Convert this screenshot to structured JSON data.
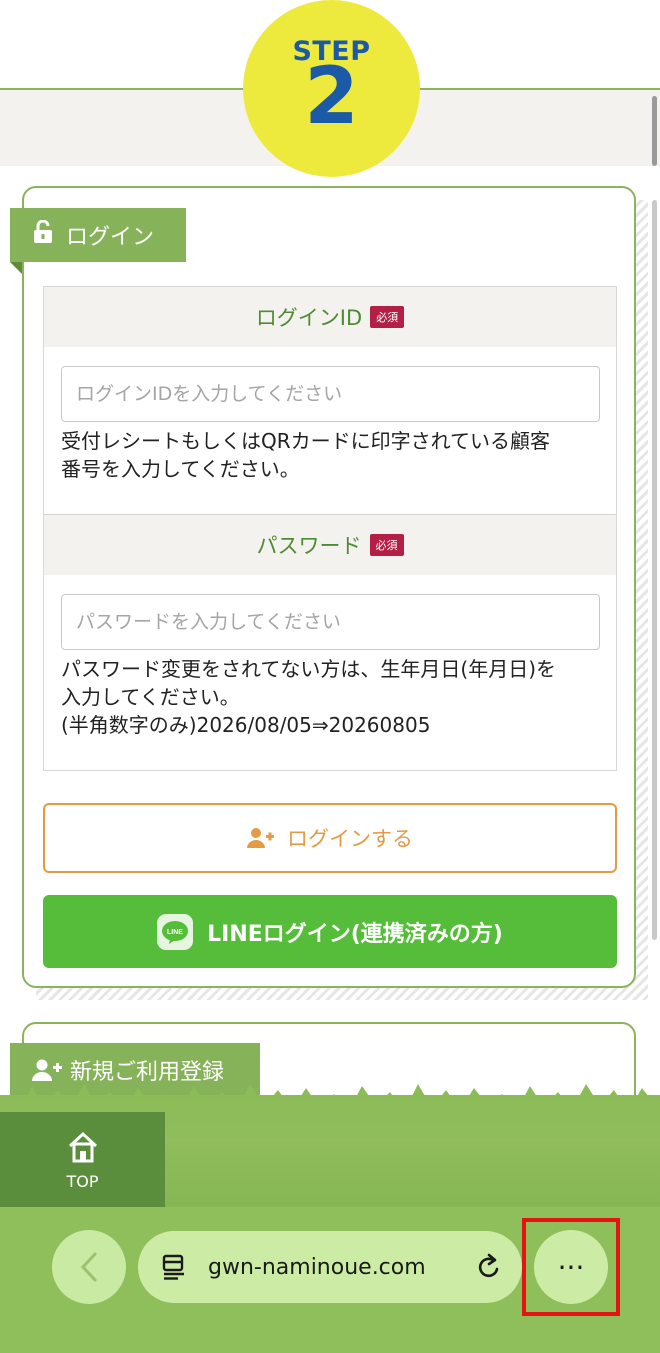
{
  "step": {
    "label": "STEP",
    "number": "2"
  },
  "login_section": {
    "title": "ログイン",
    "login_id": {
      "label": "ログインID",
      "required": "必須",
      "placeholder": "ログインIDを入力してください",
      "help": "受付レシートもしくはQRカードに印字されている顧客\n番号を入力してください。"
    },
    "password": {
      "label": "パスワード",
      "required": "必須",
      "placeholder": "パスワードを入力してください",
      "help": "パスワード変更をされてない方は、生年月日(年月日)を\n入力してください。\n(半角数字のみ)2026/08/05⇒20260805"
    },
    "login_button": "ログインする",
    "line_button": "LINEログイン(連携済みの方)",
    "line_badge": "LINE"
  },
  "register_section": {
    "title": "新規ご利用登録"
  },
  "top_nav": {
    "label": "TOP"
  },
  "browser": {
    "url": "gwn-naminoue.com",
    "more": "···"
  },
  "colors": {
    "accent_green": "#86b35a",
    "step_yellow": "#eeea3d",
    "step_blue": "#1b5aa6",
    "required_red": "#b41f45",
    "login_orange": "#e39b45",
    "line_green": "#55bd39",
    "highlight_red": "#e41414"
  }
}
